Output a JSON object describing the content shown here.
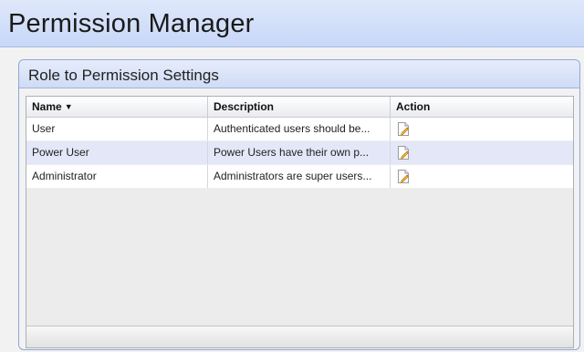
{
  "page": {
    "title": "Permission Manager"
  },
  "panel": {
    "title": "Role to Permission Settings"
  },
  "grid": {
    "columns": [
      {
        "label": "Name",
        "sorted": "descending"
      },
      {
        "label": "Description"
      },
      {
        "label": "Action"
      }
    ],
    "rows": [
      {
        "name": "User",
        "description": "Authenticated users should be...",
        "action_icon": "edit-icon"
      },
      {
        "name": "Power User",
        "description": "Power Users have their own p...",
        "action_icon": "edit-icon"
      },
      {
        "name": "Administrator",
        "description": "Administrators are super users...",
        "action_icon": "edit-icon"
      }
    ]
  },
  "colors": {
    "header_gradient_top": "#dfe8fb",
    "header_gradient_bottom": "#c8d7f7",
    "panel_border": "#8fa6d6",
    "alt_row": "#e4e7f7"
  }
}
